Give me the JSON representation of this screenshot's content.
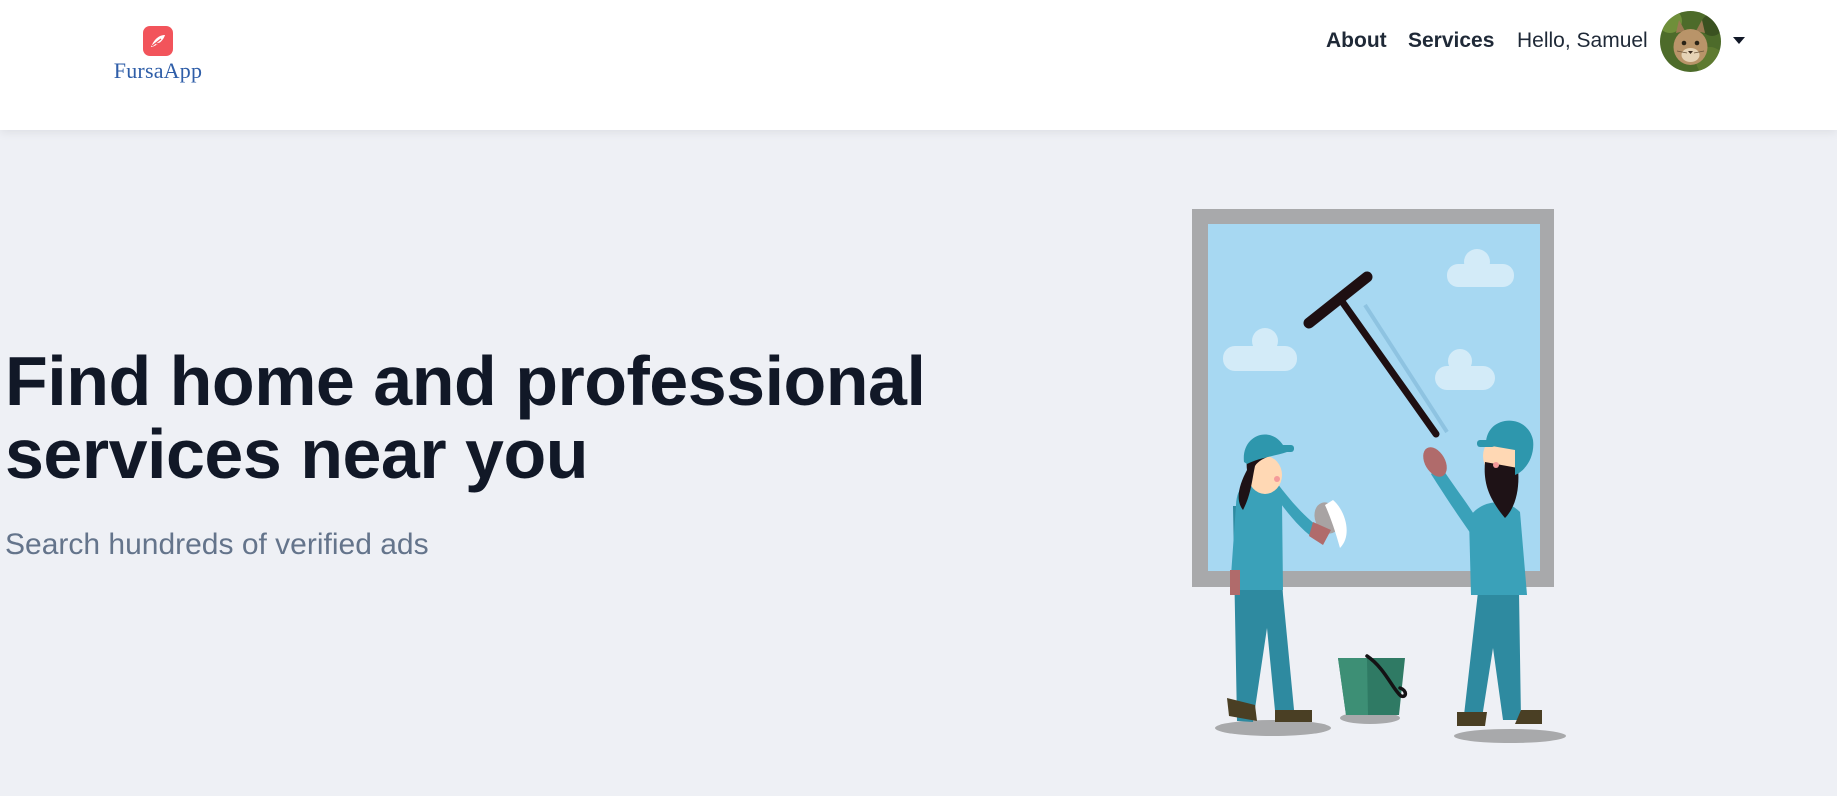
{
  "brand": {
    "name": "FursaApp",
    "badge_color": "#f2545b",
    "name_color": "#2f5ea8",
    "icon": "feather-icon"
  },
  "nav": {
    "about_label": "About",
    "services_label": "Services",
    "greeting": "Hello, Samuel",
    "avatar_icon": "user-avatar",
    "dropdown_icon": "caret-down-icon"
  },
  "hero": {
    "title": "Find home and professional services near you",
    "subtitle": "Search hundreds of verified ads",
    "illustration": "window-cleaners-illustration"
  },
  "colors": {
    "background": "#eef0f5",
    "heading": "#111827",
    "subtitle": "#64748b",
    "navbar": "#ffffff"
  }
}
